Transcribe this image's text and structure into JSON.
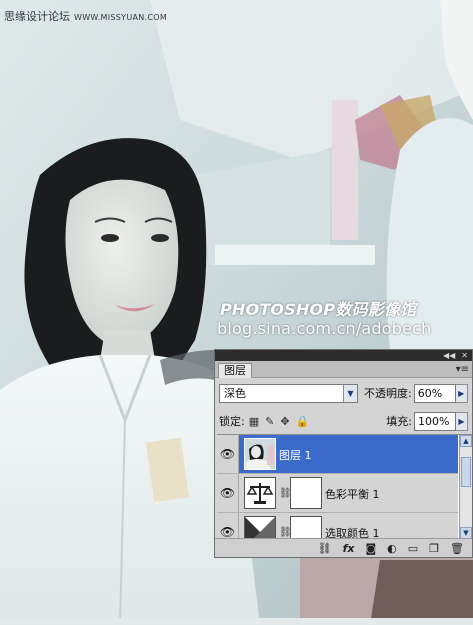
{
  "site_tag": {
    "name": "思缘设计论坛",
    "url": "WWW.MISSYUAN.COM"
  },
  "watermark": {
    "title": "PHOTOSHOP数码影像馆",
    "url": "blog.sina.com.cn/adobech"
  },
  "panel": {
    "tab_label": "图层",
    "blend_mode": "深色",
    "opacity_label": "不透明度:",
    "opacity_value": "60%",
    "lock_label": "锁定:",
    "fill_label": "填充:",
    "fill_value": "100%",
    "layers": [
      {
        "name": "图层 1",
        "selected": true,
        "thumb": "photo-thumbnail"
      },
      {
        "name": "色彩平衡 1",
        "selected": false,
        "thumb": "balance-scale-icon"
      },
      {
        "name": "选取颜色 1",
        "selected": false,
        "thumb": "selective-color-icon"
      }
    ],
    "bottom_icons": [
      "link-layers-icon",
      "fx-icon",
      "add-mask-icon",
      "adjustment-layer-icon",
      "new-group-icon",
      "new-layer-icon",
      "trash-icon"
    ],
    "colors": {
      "selection": "#3a6bcb",
      "panel_bg": "#d4d4d4"
    }
  }
}
